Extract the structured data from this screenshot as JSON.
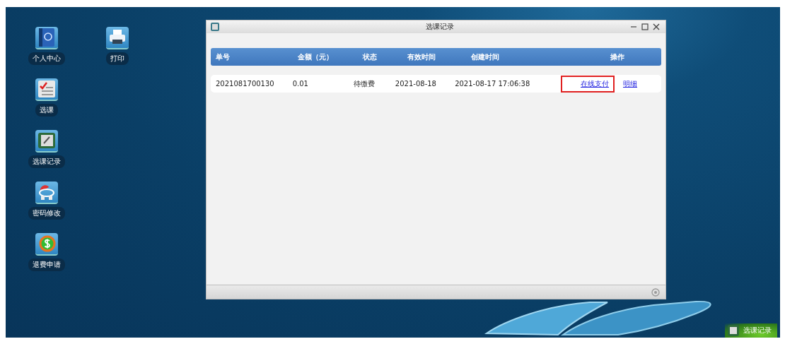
{
  "desktop": {
    "icons": [
      {
        "label": "个人中心",
        "kind": "contacts"
      },
      {
        "label": "打印",
        "kind": "printer"
      },
      {
        "label": "选课",
        "kind": "checklist"
      },
      {
        "label": "选课记录",
        "kind": "notes"
      },
      {
        "label": "密码修改",
        "kind": "password"
      },
      {
        "label": "退费申请",
        "kind": "refund"
      }
    ]
  },
  "window": {
    "title": "选课记录",
    "table": {
      "columns": [
        "单号",
        "金额（元）",
        "状态",
        "有效时间",
        "创建时间",
        "操作"
      ],
      "rows": [
        {
          "cells": [
            "2021081700130",
            "0.01",
            "待缴费",
            "2021-08-18",
            "2021-08-17 17:06:38"
          ],
          "actions": [
            {
              "label": "在线支付",
              "highlighted": true
            },
            {
              "label": "明细",
              "highlighted": false
            }
          ]
        }
      ]
    }
  },
  "taskbar": {
    "items": [
      {
        "label": "选课记录",
        "selected": true
      }
    ]
  }
}
